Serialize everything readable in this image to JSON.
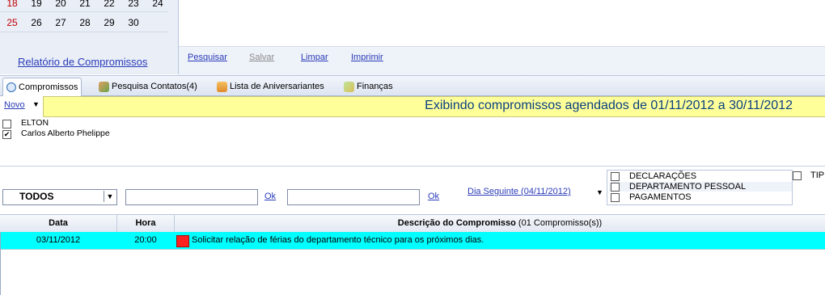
{
  "calendar": {
    "rows": [
      [
        "18",
        "19",
        "20",
        "21",
        "22",
        "23",
        "24"
      ],
      [
        "25",
        "26",
        "27",
        "28",
        "29",
        "30"
      ]
    ]
  },
  "report_link": "Relatório de Compromissos",
  "top_actions": {
    "search": "Pesquisar",
    "save": "Salvar",
    "clear": "Limpar",
    "print": "Imprimir"
  },
  "tabs": [
    {
      "label": "Compromissos",
      "icon": "clock-icon"
    },
    {
      "label": "Pesquisa Contatos(4)",
      "icon": "contacts-icon"
    },
    {
      "label": "Lista de Aniversariantes",
      "icon": "birthday-cake-icon"
    },
    {
      "label": "Finanças",
      "icon": "money-icon"
    }
  ],
  "new_link": "Novo",
  "info_text": "Exibindo compromissos agendados de 01/11/2012 a 30/11/2012",
  "people": [
    {
      "name": "ELTON",
      "checked": false
    },
    {
      "name": "Carlos Alberto Phelippe",
      "checked": true
    }
  ],
  "filter": {
    "select_value": "TODOS",
    "ok1": "Ok",
    "ok2": "Ok",
    "next_day": "Dia Seguinte (04/11/2012)"
  },
  "categories": [
    "DECLARAÇÕES",
    "DEPARTAMENTO PESSOAL",
    "PAGAMENTOS"
  ],
  "tipo_label": "TIP",
  "table": {
    "headers": {
      "date": "Data",
      "time": "Hora",
      "desc": "Descrição do Compromisso",
      "desc_count": "(01 Compromisso(s))"
    },
    "rows": [
      {
        "date": "03/11/2012",
        "time": "20:00",
        "desc": "Solicitar relação de férias do departamento técnico para os próximos dias.",
        "color": "#ff2020"
      }
    ]
  },
  "colors": {
    "info_bar": "#ffff99",
    "selected_row": "#00ffff",
    "link": "#2a3bb8"
  }
}
